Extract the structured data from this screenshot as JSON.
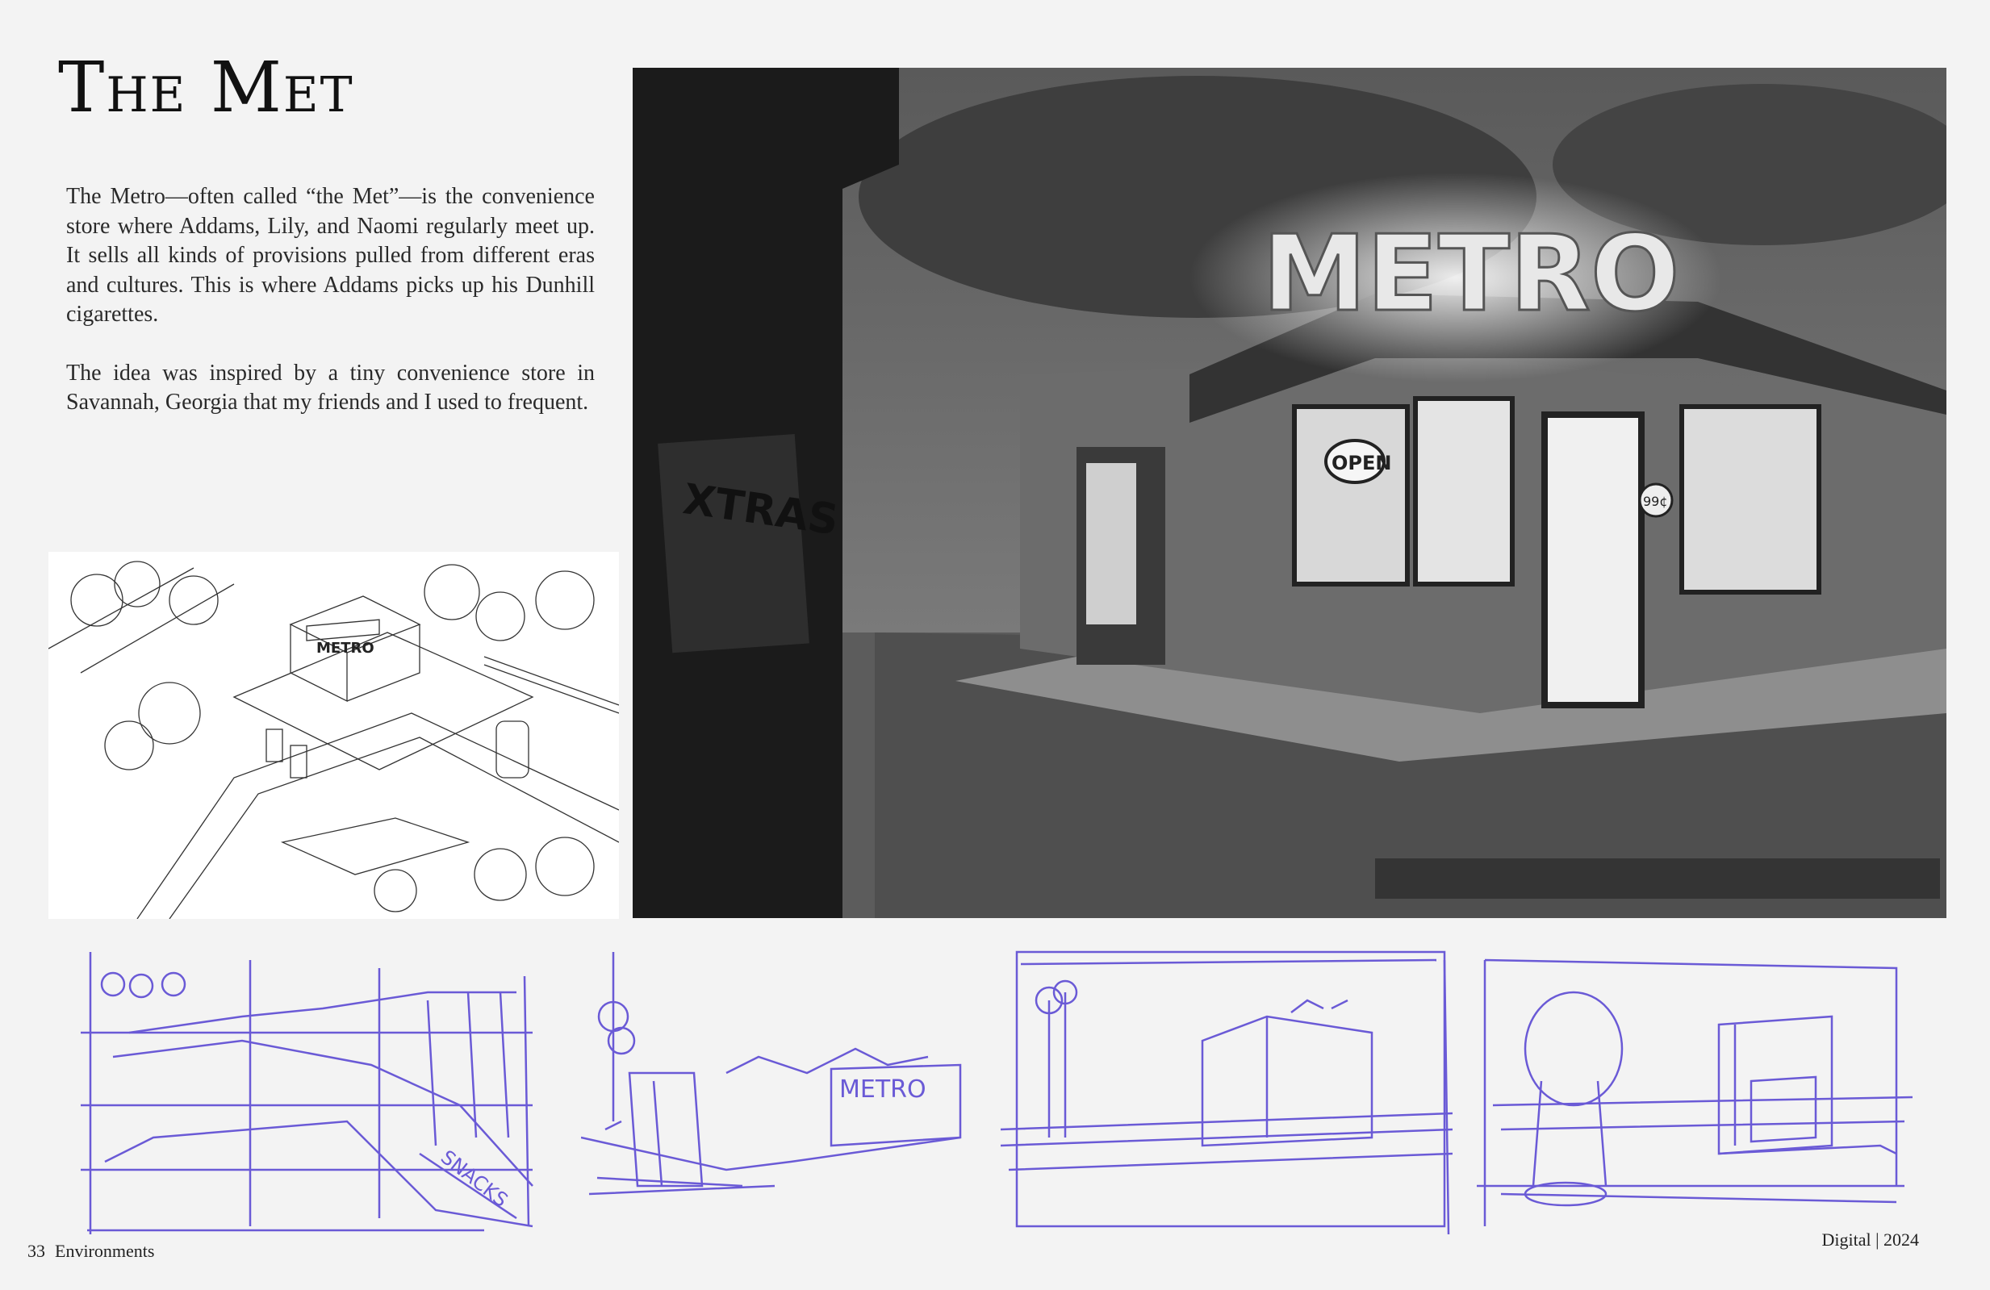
{
  "title": "The Met",
  "paragraphs": [
    "The Metro—often called “the Met”—is the convenience store where Addams, Lily, and Naomi regularly meet up. It sells all kinds of provisions pulled from different eras and cultures. This is where Addams picks up his Dunhill cigarettes.",
    "The idea was inspired by a tiny convenience store in Savannah, Georgia that my friends and I used to frequent."
  ],
  "illustration": {
    "sign_text": "METRO",
    "open_sign": "OPEN",
    "poster_text": "XTRAS",
    "sticker_text": "99¢",
    "iso_sign_text": "METRO"
  },
  "thumbnails": {
    "snacks_sign": "SNACKS",
    "sign_text": "METRO"
  },
  "footer": {
    "page_number": "33",
    "section": "Environments",
    "medium_year": "Digital | 2024"
  },
  "colors": {
    "sketch_blue": "#6a5ad6",
    "background": "#f3f3f3"
  }
}
